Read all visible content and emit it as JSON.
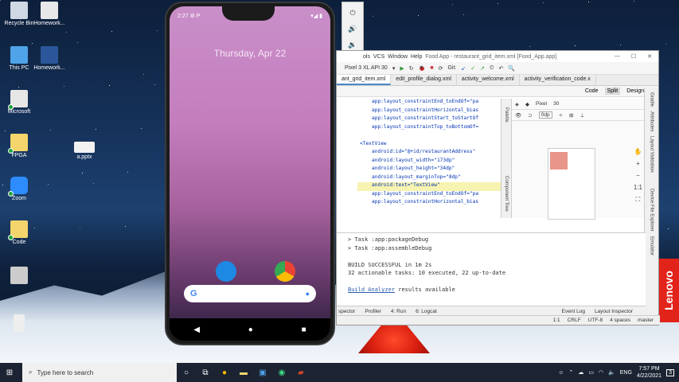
{
  "desktop": {
    "icons": [
      {
        "label": "Recycle Bin"
      },
      {
        "label": "Homework..."
      },
      {
        "label": "This PC"
      },
      {
        "label": "Homework..."
      },
      {
        "label": "Microsoft"
      },
      {
        "label": "FPGA"
      },
      {
        "label": "a.pptx"
      },
      {
        "label": "Zoom"
      },
      {
        "label": "Code"
      }
    ],
    "brand": "Lenovo"
  },
  "phone": {
    "status_left": "2:27 ⚙ P",
    "status_right": "▾◢ ▮",
    "date": "Thursday, Apr 22",
    "nav": [
      "◀",
      "●",
      "■"
    ]
  },
  "emulator_toolbar": [
    "⏻",
    "🔊",
    "🔉",
    "⟲",
    "⟳",
    "📷",
    "🔍",
    "◁",
    "○",
    "□",
    "⋯"
  ],
  "ide": {
    "title_menu": [
      "ols",
      "VCS",
      "Window",
      "Help"
    ],
    "title_text": "Food App - restaurant_grid_item.xml [Food_App.app]",
    "device": "Pixel 3 XL API 30",
    "git_label": "Git:",
    "tabs": [
      {
        "label": "ant_grid_item.xml",
        "active": true
      },
      {
        "label": "edit_profile_dialog.xml",
        "active": false
      },
      {
        "label": "activity_welcome.xml",
        "active": false
      },
      {
        "label": "activity_verification_code.x",
        "active": false
      }
    ],
    "view_modes": [
      "Code",
      "Split",
      "Design"
    ],
    "code_lines": [
      {
        "text": "app:layout_constraintEnd_toEndOf=\"pa",
        "indent": 6,
        "hl": false
      },
      {
        "text": "app:layout_constraintHorizontal_bias",
        "indent": 6,
        "hl": false
      },
      {
        "text": "app:layout_constraintStart_toStartOf",
        "indent": 6,
        "hl": false
      },
      {
        "text": "app:layout_constraintTop_toBottomOf=",
        "indent": 6,
        "hl": false
      },
      {
        "text": "",
        "indent": 0,
        "hl": false
      },
      {
        "text": "<TextView",
        "indent": 1,
        "hl": false
      },
      {
        "text": "android:id=\"@+id/restaurantAddress\"",
        "indent": 6,
        "hl": false
      },
      {
        "text": "android:layout_width=\"173dp\"",
        "indent": 6,
        "hl": false
      },
      {
        "text": "android:layout_height=\"34dp\"",
        "indent": 6,
        "hl": false
      },
      {
        "text": "android:layout_marginTop=\"8dp\"",
        "indent": 6,
        "hl": false
      },
      {
        "text": "android:text=\"TextView\"",
        "indent": 6,
        "hl": true
      },
      {
        "text": "app:layout_constraintEnd_toEndOf=\"pa",
        "indent": 6,
        "hl": false
      },
      {
        "text": "app:layout_constraintHorizontal_bias",
        "indent": 6,
        "hl": false
      }
    ],
    "palette_label": "Palette",
    "component_tree_label": "Component Tree",
    "design_tools": [
      "Pixel",
      "30",
      "0dp"
    ],
    "zoom_tools": [
      "✋",
      "+",
      "−",
      "1:1",
      "⛶"
    ],
    "right_strip": [
      "Gradle",
      "Attributes",
      "Layout Validation",
      "Device File Explorer",
      "Emulator"
    ],
    "build_lines": [
      "> Task :app:packageDebug",
      "> Task :app:assembleDebug",
      "",
      "BUILD SUCCESSFUL in 1m 2s",
      "32 actionable tasks: 10 executed, 22 up-to-date",
      ""
    ],
    "build_link": "Build Analyzer",
    "build_link_suffix": " results available",
    "bottom_tabs": [
      "spector",
      "Profiler",
      "4: Run",
      "6: Logcat",
      "Event Log",
      "Layout Inspector"
    ],
    "status": [
      "1:1",
      "CRLF",
      "UTF-8",
      "4 spaces",
      "master"
    ]
  },
  "taskbar": {
    "search_placeholder": "Type here to search",
    "lang": "ENG",
    "time": "7:57 PM",
    "date": "4/22/2021",
    "notif": "3"
  }
}
